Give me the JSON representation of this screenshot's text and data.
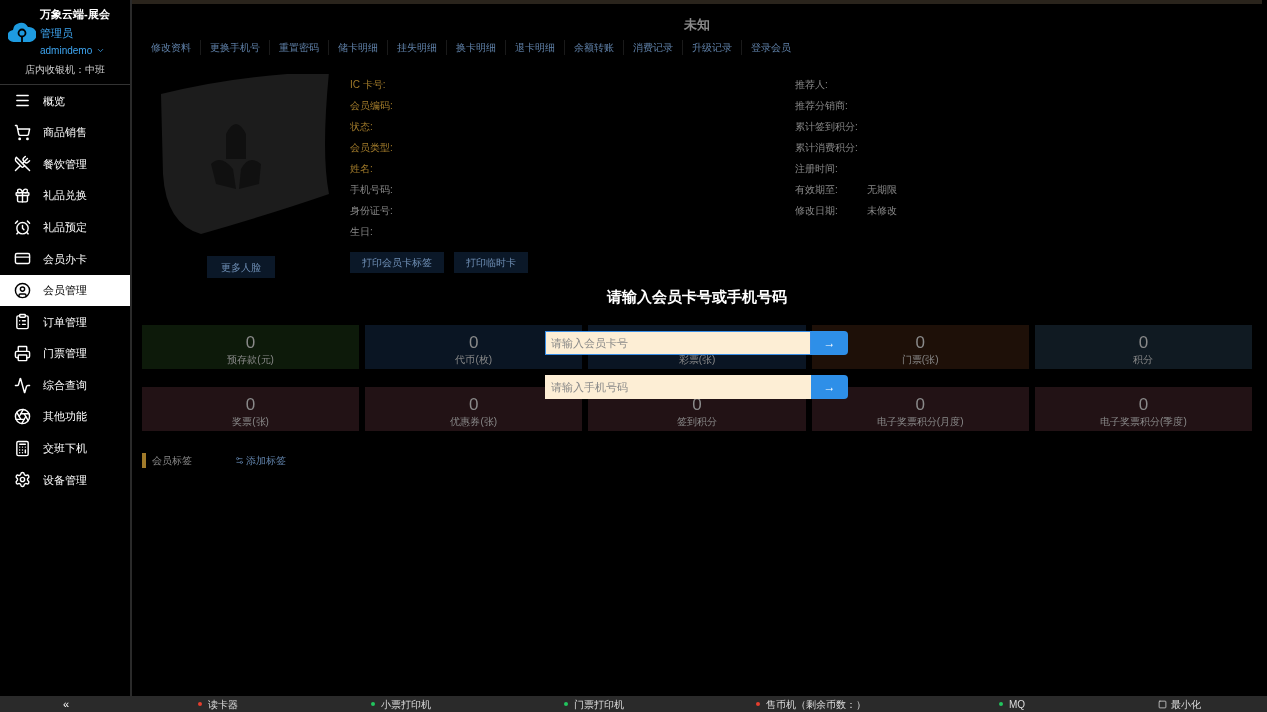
{
  "brand": {
    "name": "万象云端-展会",
    "role": "管理员",
    "user": "admindemo",
    "register": "店内收银机：中班"
  },
  "nav": [
    {
      "label": "概览",
      "selected": false
    },
    {
      "label": "商品销售",
      "selected": false
    },
    {
      "label": "餐饮管理",
      "selected": false
    },
    {
      "label": "礼品兑换",
      "selected": false
    },
    {
      "label": "礼品预定",
      "selected": false
    },
    {
      "label": "会员办卡",
      "selected": false
    },
    {
      "label": "会员管理",
      "selected": true
    },
    {
      "label": "订单管理",
      "selected": false
    },
    {
      "label": "门票管理",
      "selected": false
    },
    {
      "label": "综合查询",
      "selected": false
    },
    {
      "label": "其他功能",
      "selected": false
    },
    {
      "label": "交班下机",
      "selected": false
    },
    {
      "label": "设备管理",
      "selected": false
    }
  ],
  "member": {
    "title": "未知",
    "tabs": [
      "修改资料",
      "更换手机号",
      "重置密码",
      "储卡明细",
      "挂失明细",
      "换卡明细",
      "退卡明细",
      "余额转账",
      "消费记录",
      "升级记录",
      "登录会员"
    ],
    "more_faces": "更多人脸",
    "left_fields": [
      {
        "label": "IC 卡号:",
        "kind": "key"
      },
      {
        "label": "会员编码:",
        "kind": "key"
      },
      {
        "label": "状态:",
        "kind": "key"
      },
      {
        "label": "会员类型:",
        "kind": "key"
      },
      {
        "label": "姓名:",
        "kind": "key"
      },
      {
        "label": "手机号码:",
        "kind": "plain"
      },
      {
        "label": "身份证号:",
        "kind": "plain"
      },
      {
        "label": "生日:",
        "kind": "plain"
      }
    ],
    "right_fields": [
      {
        "label": "推荐人:"
      },
      {
        "label": "推荐分销商:"
      },
      {
        "label": "累计签到积分:"
      },
      {
        "label": "累计消费积分:"
      },
      {
        "label": "注册时间:"
      },
      {
        "label": "有效期至:",
        "value": "无期限"
      },
      {
        "label": "修改日期:",
        "value": "未修改"
      }
    ],
    "actions": [
      "打印会员卡标签",
      "打印临时卡"
    ],
    "stats": [
      {
        "value": "0",
        "label": "预存款(元)",
        "color": "#0d1a0a"
      },
      {
        "value": "0",
        "label": "代币(枚)",
        "color": "#0a1523"
      },
      {
        "label": "彩票(张)",
        "color": "#0a1523"
      },
      {
        "value": "0",
        "label": "门票(张)",
        "color": "#1e1008"
      },
      {
        "value": "0",
        "label": "积分",
        "color": "#101a22"
      },
      {
        "value": "0",
        "label": "奖票(张)",
        "color": "#221215"
      },
      {
        "value": "0",
        "label": "优惠券(张)",
        "color": "#221215"
      },
      {
        "value": "0",
        "label": "签到积分",
        "color": "#221215"
      },
      {
        "value": "0",
        "label": "电子奖票积分(月度)",
        "color": "#221215"
      },
      {
        "value": "0",
        "label": "电子奖票积分(季度)",
        "color": "#221215"
      }
    ],
    "tags_label": "会员标签",
    "add_tag": "添加标签"
  },
  "dialog": {
    "title": "请输入会员卡号或手机号码",
    "fields": [
      {
        "placeholder": "请输入会员卡号",
        "button": "→",
        "focused": true
      },
      {
        "placeholder": "请输入手机号码",
        "button": "→",
        "focused": false
      }
    ]
  },
  "status_bar": {
    "collapse": "«",
    "devices": [
      {
        "label": "读卡器",
        "color": "#e53e2e"
      },
      {
        "label": "小票打印机",
        "color": "#22c55e"
      },
      {
        "label": "门票打印机",
        "color": "#22c55e"
      },
      {
        "label": "售币机（剩余币数：）",
        "color": "#e53e2e"
      },
      {
        "label": "MQ",
        "color": "#22c55e"
      }
    ],
    "minimize": "最小化"
  }
}
